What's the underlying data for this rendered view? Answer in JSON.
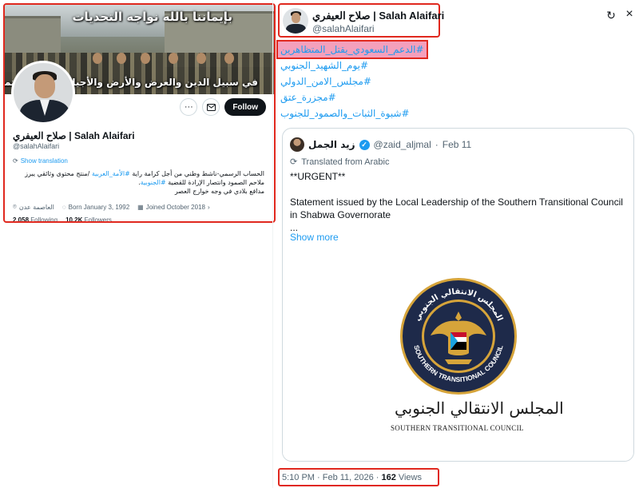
{
  "profile": {
    "banner_text_top": "بإيماننا بالله نواجه التحديات",
    "banner_text_bottom": "في سبيل الدين والعرض والأرض والأجيال.. نحن مستمرون",
    "name": "صلاح العيفري | Salah Alaifari",
    "handle": "@salahAlaifari",
    "follow_label": "Follow",
    "more_label": "···",
    "message_icon": "envelope-icon",
    "show_translation": "Show translation",
    "bio_line1_a": "الحساب الرسمي-ناشط وطني من أجل كرامة راية",
    "bio_line1_tag": "#الأمة_العربية",
    "bio_line1_b": "/منتج محتوى وثائقي يبرز",
    "bio_line2_a": "ملاحم الصمود وانتصار الإرادة للقضية",
    "bio_line2_tag": "#الجنوبية",
    "bio_line2_b": ".",
    "bio_line3": "مدافع بلادي في وجه خوارج العصر",
    "location": "العاصمة عدن",
    "born": "Born January 3, 1992",
    "joined": "Joined October 2018",
    "following_count": "2,058",
    "following_label": "Following",
    "followers_count": "10.2K",
    "followers_label": "Followers"
  },
  "tweet": {
    "author_name": "صلاح العيفري | Salah Alaifari",
    "author_handle": "@salahAlaifari",
    "hashtags": [
      "#الدعم_السعودي_يقتل_المتظاهرين",
      "#يوم_الشهيد_الجنوبي",
      "#مجلس_الامن_الدولي",
      "#مجزرة_عتق",
      "#شبوة_الثبات_والصمود_للجنوب"
    ],
    "timestamp": "5:10 PM · Feb 11, 2026 ·",
    "views_count": "162",
    "views_label": "Views"
  },
  "quote": {
    "name": "زيد الجمل",
    "handle": "@zaid_aljmal",
    "dot": "·",
    "date": "Feb 11",
    "translated_label": "Translated from Arabic",
    "line1": "**URGENT**",
    "line2": "Statement issued by the Local Leadership of the Southern Transitional Council in Shabwa Governorate",
    "line3": "...",
    "show_more": "Show more",
    "logo_arabic": "المجلس الانتقالي الجنوبي",
    "logo_english": "SOUTHERN TRANSITIONAL COUNCIL",
    "seal_ring_arabic": "المجلس الانتقالي الجنوبي",
    "seal_ring_english": "SOUTHERN TRANSITIONAL COUNCIL"
  },
  "colors": {
    "accent": "#1d9bf0",
    "annotation_red": "#e0281e",
    "hashtag_highlight": "#f4a0bc",
    "seal_navy": "#1e2a4a",
    "seal_gold": "#d6a43a"
  }
}
